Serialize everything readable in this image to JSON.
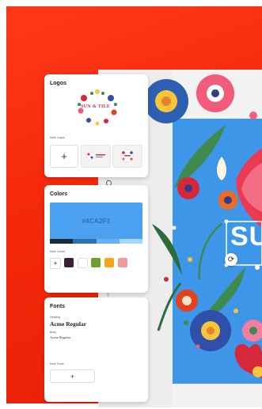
{
  "logos_panel": {
    "title": "Logos",
    "logo_text": "SUN & TILE",
    "more_logos_label": "More Logos",
    "add_icon": "plus-icon"
  },
  "colors_panel": {
    "title": "Colors",
    "primary_hex": "#4CA2F1",
    "primary_color": "#4CA2F1",
    "palette_strip": [
      "#1c2a3a",
      "#2e6fae",
      "#66b3f5",
      "#a8d6fb"
    ],
    "more_colors_label": "More Colors",
    "add_icon": "plus-icon",
    "swatches": [
      "#3a2038",
      "#ffffff",
      "#6d9e2e",
      "#f2a81c",
      "#f09a9a"
    ]
  },
  "fonts_panel": {
    "title": "Fonts",
    "heading_label": "Heading",
    "heading_font": "Acme Regular",
    "body_label": "Body",
    "body_font": "Acme Regular",
    "more_fonts_label": "More Fonts",
    "add_icon": "plus-icon"
  },
  "canvas": {
    "artboard_text": "SU",
    "rotate_icon": "rotate-icon",
    "artboard_color": "#3e96e8"
  },
  "colors": {
    "background_gradient_start": "#ff3a1a",
    "background_gradient_end": "#e81f05"
  }
}
